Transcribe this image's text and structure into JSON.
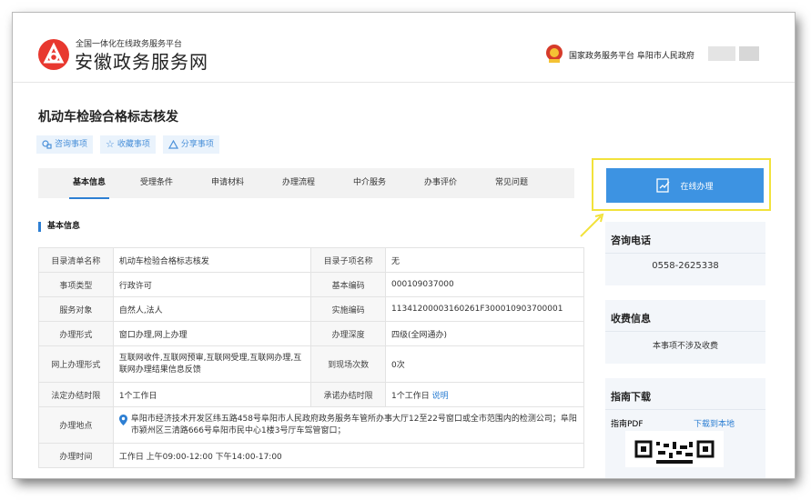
{
  "header": {
    "brand_sub": "全国一体化在线政务服务平台",
    "brand_main": "安徽政务服务网",
    "platform_link": "国家政务服务平台 阜阳市人民政府",
    "accent_color": "#e8382f"
  },
  "page": {
    "title": "机动车检验合格标志核发"
  },
  "actions": [
    {
      "label": "咨询事项",
      "icon": "chat-icon"
    },
    {
      "label": "收藏事项",
      "icon": "star-icon"
    },
    {
      "label": "分享事项",
      "icon": "share-icon"
    }
  ],
  "tabs": [
    "基本信息",
    "受理条件",
    "申请材料",
    "办理流程",
    "中介服务",
    "办事评价",
    "常见问题"
  ],
  "active_tab": "基本信息",
  "section": {
    "title": "基本信息"
  },
  "info": {
    "catalog_name_label": "目录清单名称",
    "catalog_name": "机动车检验合格标志核发",
    "sub_item_label": "目录子项名称",
    "sub_item": "无",
    "type_label": "事项类型",
    "type": "行政许可",
    "basic_code_label": "基本编码",
    "basic_code": "000109037000",
    "target_label": "服务对象",
    "target": "自然人,法人",
    "impl_code_label": "实施编码",
    "impl_code": "11341200003160261F300010903700001",
    "form_label": "办理形式",
    "form": "窗口办理,网上办理",
    "depth_label": "办理深度",
    "depth": "四级(全网通办)",
    "online_form_label": "网上办理形式",
    "online_form": "互联网收件,互联网预审,互联网受理,互联网办理,互联网办理结果信息反馈",
    "visits_label": "到现场次数",
    "visits": "0次",
    "legal_limit_label": "法定办结时限",
    "legal_limit": "1个工作日",
    "promise_limit_label": "承诺办结时限",
    "promise_limit": "1个工作日",
    "promise_note": "说明",
    "location_label": "办理地点",
    "location": "阜阳市经济技术开发区纬五路458号阜阳市人民政府政务服务车管所办事大厅12至22号窗口或全市范围内的检测公司；阜阳市颍州区三清路666号阜阳市民中心1楼3号厅车驾管窗口；",
    "time_label": "办理时间",
    "time": "工作日 上午09:00-12:00 下午14:00-17:00"
  },
  "sidebar": {
    "online_button": "在线办理",
    "hotline_title": "咨询电话",
    "hotline": "0558-2625338",
    "fee_title": "收费信息",
    "fee_text": "本事项不涉及收费",
    "guide_title": "指南下载",
    "guide_label": "指南PDF",
    "guide_link": "下载到本地",
    "highlight_color": "#f2e23b"
  }
}
